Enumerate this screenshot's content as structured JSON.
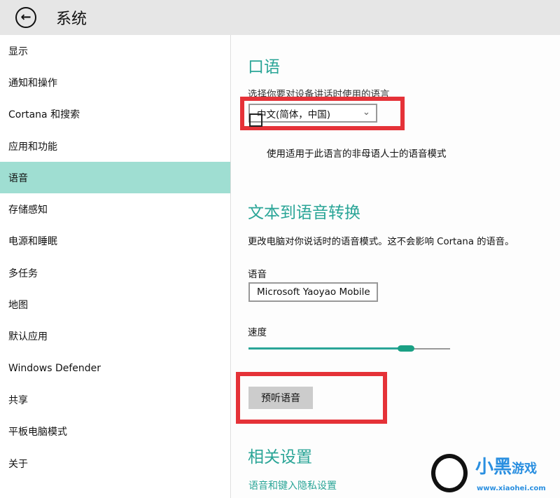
{
  "header": {
    "title": "系统",
    "back_icon": "arrow-left-icon"
  },
  "sidebar": {
    "items": [
      {
        "label": "显示"
      },
      {
        "label": "通知和操作"
      },
      {
        "label": "Cortana 和搜索"
      },
      {
        "label": "应用和功能"
      },
      {
        "label": "语音",
        "selected": true
      },
      {
        "label": "存储感知"
      },
      {
        "label": "电源和睡眠"
      },
      {
        "label": "多任务"
      },
      {
        "label": "地图"
      },
      {
        "label": "默认应用"
      },
      {
        "label": "Windows Defender"
      },
      {
        "label": "共享"
      },
      {
        "label": "平板电脑模式"
      },
      {
        "label": "关于"
      }
    ]
  },
  "speech": {
    "heading": "口语",
    "language_label": "选择你要对设备讲话时使用的语言",
    "language_value": "中文(简体，中国)",
    "nonnative_label": "使用适用于此语言的非母语人士的语音模式",
    "nonnative_checked": false
  },
  "tts": {
    "heading": "文本到语音转换",
    "description": "更改电脑对你说话时的语音模式。这不会影响 Cortana 的语音。",
    "voice_label": "语音",
    "voice_value": "Microsoft Yaoyao Mobile",
    "speed_label": "速度",
    "speed_fraction": 0.78,
    "preview_button": "预听语音"
  },
  "related": {
    "heading": "相关设置",
    "link": "语音和键入隐私设置"
  },
  "watermark": {
    "text": "小黑游戏",
    "url": "www.xiaohei.com"
  },
  "colors": {
    "accent": "#2aa597",
    "selected": "#9fded2",
    "highlight": "#e53238"
  }
}
